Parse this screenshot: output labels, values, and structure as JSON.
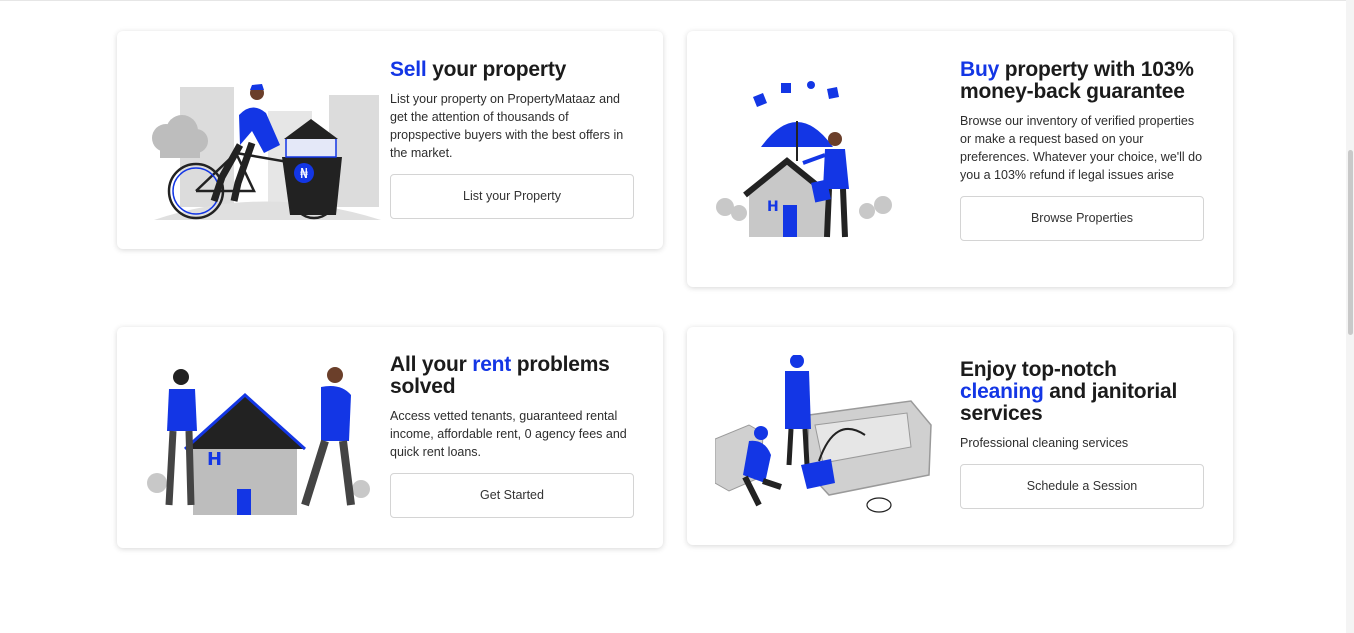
{
  "cards": [
    {
      "title_accent": "Sell",
      "title_rest": " your property",
      "description": "List your property on PropertyMataaz and get the attention of thousands of propspective buyers with the best offers in the market.",
      "button": "List your Property"
    },
    {
      "title_accent": "Buy",
      "title_rest": " property with 103% money-back guarantee",
      "description": "Browse our inventory of verified properties or make a request based on your preferences. Whatever your choice, we'll do you a 103% refund if legal issues arise",
      "button": "Browse Properties"
    },
    {
      "title_pre": "All your ",
      "title_accent": "rent",
      "title_rest": " problems solved",
      "description": "Access vetted tenants, guaranteed rental income, affordable rent, 0 agency fees and quick rent loans.",
      "button": "Get Started"
    },
    {
      "title_pre": "Enjoy top-notch ",
      "title_accent": "cleaning",
      "title_rest": " and janitorial services",
      "description": "Professional cleaning services",
      "button": "Schedule a Session"
    }
  ],
  "illustrations": {
    "house_letter": "H",
    "currency_symbol": "₦"
  },
  "colors": {
    "accent": "#1336e5",
    "text": "#1b1b1b",
    "gray": "#9a9a9a"
  }
}
